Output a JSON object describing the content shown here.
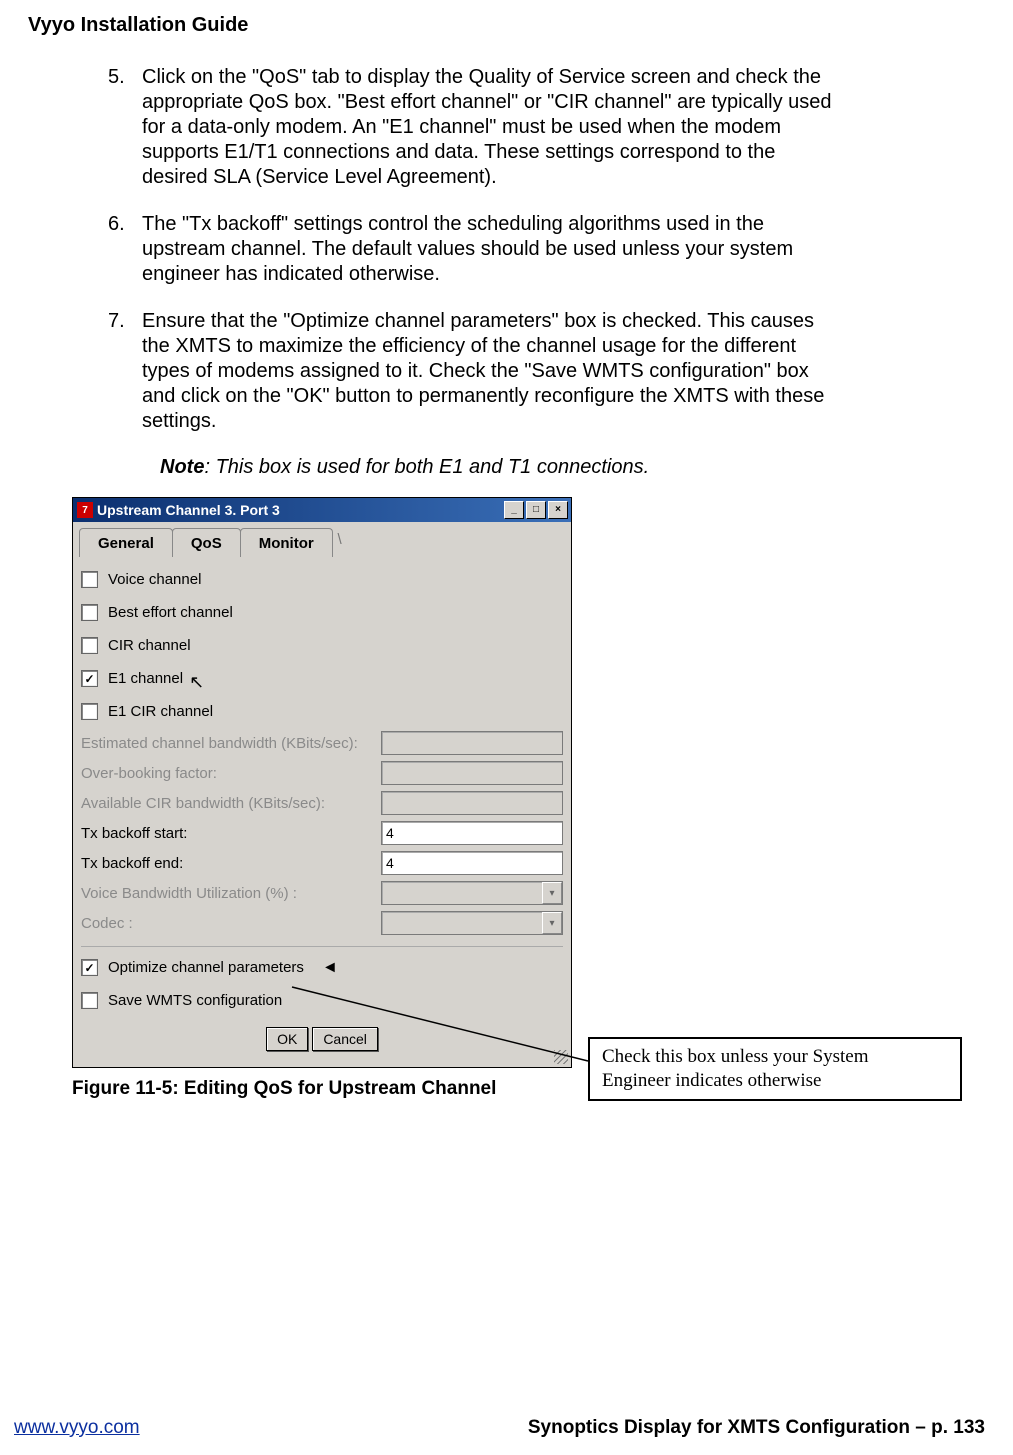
{
  "header": {
    "title": "Vyyo Installation Guide"
  },
  "list": {
    "items": [
      {
        "num": "5.",
        "text": "Click on the \"QoS\" tab to display the Quality of Service screen and check the appropriate QoS box. \"Best effort channel\" or \"CIR channel\" are typically used for a data-only modem.  An \"E1 channel\" must be used when the modem supports E1/T1 connections and data.  These settings correspond to the desired SLA (Service Level Agreement)."
      },
      {
        "num": "6.",
        "text": "The \"Tx backoff\" settings control the scheduling algorithms used in the upstream channel.  The default values should be used unless your system engineer has indicated otherwise."
      },
      {
        "num": "7.",
        "text": "Ensure that the \"Optimize channel parameters\" box is checked.  This causes the XMTS to maximize the efficiency of the channel usage for the different types of modems assigned to it.  Check the \"Save WMTS configuration\" box and click on the \"OK\" button to permanently reconfigure the XMTS with these settings."
      }
    ]
  },
  "note": {
    "label": "Note",
    "text": ": This box is used for both E1 and T1 connections."
  },
  "dialog": {
    "title": "Upstream Channel 3. Port 3",
    "tabs": {
      "general": "General",
      "qos": "QoS",
      "monitor": "Monitor"
    },
    "checks": {
      "voice": "Voice channel",
      "best": "Best effort channel",
      "cir": "CIR channel",
      "e1": "E1 channel",
      "e1cir": "E1  CIR channel",
      "optimize": "Optimize channel parameters",
      "save": "Save WMTS configuration"
    },
    "fields": {
      "est_bw": "Estimated channel bandwidth (KBits/sec):",
      "overbook": "Over-booking factor:",
      "avail_cir": "Available CIR bandwidth (KBits/sec):",
      "tx_start_label": "Tx backoff start:",
      "tx_start_value": "4",
      "tx_end_label": "Tx backoff end:",
      "tx_end_value": "4",
      "voice_util": "Voice Bandwidth Utilization (%) :",
      "codec": "Codec :"
    },
    "buttons": {
      "ok": "OK",
      "cancel": "Cancel"
    },
    "icons": {
      "min": "_",
      "max": "□",
      "close": "×",
      "dd": "▾",
      "check": "✓",
      "grip": ""
    }
  },
  "callout": {
    "text1": "Check  this box unless your System",
    "text2": "Engineer indicates otherwise"
  },
  "figure": {
    "caption": "Figure 11-5: Editing QoS for Upstream Channel"
  },
  "footer": {
    "left": "www.vyyo.com",
    "right": "Synoptics Display for XMTS Configuration – p. 133"
  }
}
